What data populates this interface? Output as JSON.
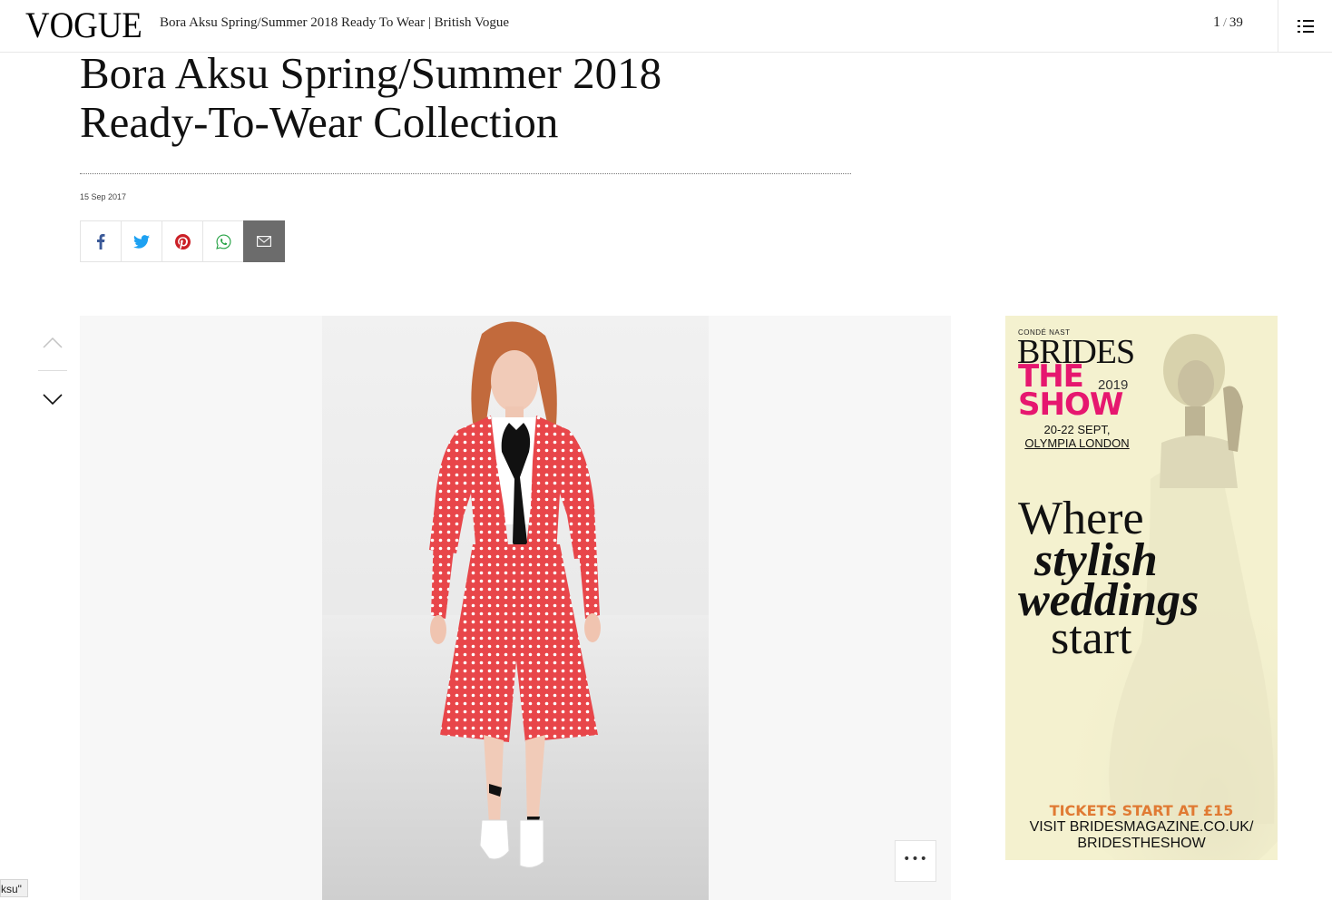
{
  "header": {
    "logo": "VOGUE",
    "document_title": "Bora Aksu Spring/Summer 2018 Ready To Wear | British Vogue",
    "counter_current": "1",
    "counter_sep": "/",
    "counter_total": "39"
  },
  "article": {
    "headline_line1": "Bora Aksu Spring/Summer 2018",
    "headline_line2": "Ready-To-Wear Collection",
    "date": "15 Sep 2017"
  },
  "share": {
    "icons": [
      "facebook-icon",
      "twitter-icon",
      "pinterest-icon",
      "whatsapp-icon",
      "email-icon"
    ]
  },
  "ad": {
    "publisher": "CONDÉ NAST",
    "brand": "BRIDES",
    "the_show_1": "THE",
    "the_show_2": "SHOW",
    "year": "2019",
    "dates": "20-22 SEPT,",
    "venue": "OLYMPIA LONDON",
    "tagline_1": "Where",
    "tagline_2": "stylish",
    "tagline_3": "weddings",
    "tagline_4": "start",
    "tickets": "TICKETS START AT £15",
    "visit_1": "VISIT BRIDESMAGAZINE.CO.UK/",
    "visit_2": "BRIDESTHESHOW"
  },
  "status_tooltip": "ksu\"",
  "colors": {
    "ad_background": "#f4f1cf",
    "ad_accent_pink": "#e6176f",
    "ad_accent_orange": "#e07a33",
    "facebook": "#3b5998",
    "twitter": "#1da1f2",
    "pinterest": "#cb2027",
    "whatsapp": "#25a244",
    "email_bg": "#6c6c6c"
  }
}
